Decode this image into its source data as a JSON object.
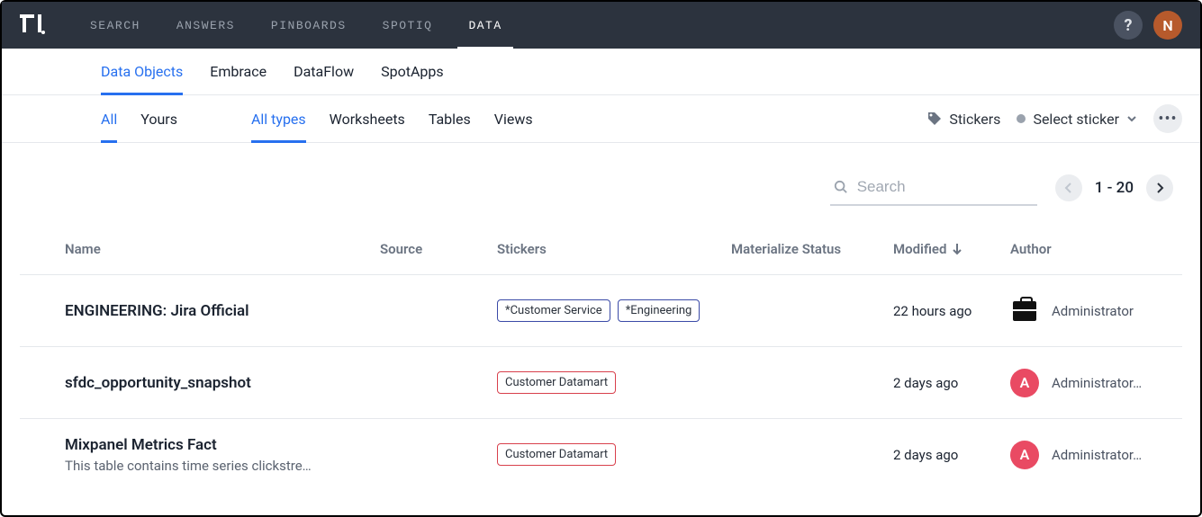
{
  "topnav": {
    "items": [
      "SEARCH",
      "ANSWERS",
      "PINBOARDS",
      "SPOTIQ",
      "DATA"
    ],
    "active_index": 4,
    "help": "?",
    "avatar_initial": "N"
  },
  "subtabs": {
    "items": [
      "Data Objects",
      "Embrace",
      "DataFlow",
      "SpotApps"
    ],
    "active_index": 0
  },
  "filters": {
    "ownership": {
      "items": [
        "All",
        "Yours"
      ],
      "active_index": 0
    },
    "type": {
      "items": [
        "All types",
        "Worksheets",
        "Tables",
        "Views"
      ],
      "active_index": 0
    },
    "stickers_label": "Stickers",
    "select_sticker_label": "Select sticker"
  },
  "search": {
    "placeholder": "Search",
    "value": ""
  },
  "pagination": {
    "range": "1 - 20"
  },
  "table": {
    "headers": [
      "Name",
      "Source",
      "Stickers",
      "Materialize Status",
      "Modified",
      "Author"
    ],
    "sort_column": "Modified",
    "sort_dir": "desc",
    "rows": [
      {
        "name": "ENGINEERING: Jira Official",
        "desc": "",
        "source": "",
        "stickers": [
          {
            "label": "*Customer Service",
            "color": "navy"
          },
          {
            "label": "*Engineering",
            "color": "navy"
          }
        ],
        "materialize": "",
        "modified": "22 hours ago",
        "author": {
          "label": "Administrator",
          "avatar": "briefcase",
          "initial": ""
        }
      },
      {
        "name": "sfdc_opportunity_snapshot",
        "desc": "",
        "source": "",
        "stickers": [
          {
            "label": "Customer Datamart",
            "color": "crimson"
          }
        ],
        "materialize": "",
        "modified": "2 days ago",
        "author": {
          "label": "Administrator…",
          "avatar": "red",
          "initial": "A"
        }
      },
      {
        "name": "Mixpanel Metrics Fact",
        "desc": "This table contains time series clickstre…",
        "source": "",
        "stickers": [
          {
            "label": "Customer Datamart",
            "color": "crimson"
          }
        ],
        "materialize": "",
        "modified": "2 days ago",
        "author": {
          "label": "Administrator…",
          "avatar": "red",
          "initial": "A"
        }
      }
    ]
  }
}
